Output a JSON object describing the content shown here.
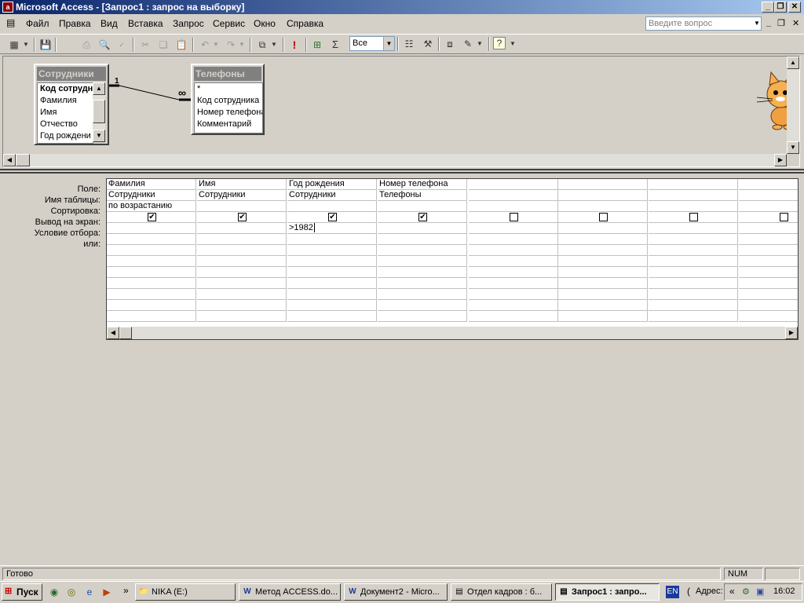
{
  "window": {
    "title": "Microsoft Access - [Запрос1 : запрос на выборку]",
    "app_icon": "access-icon"
  },
  "menubar": {
    "items": [
      "Файл",
      "Правка",
      "Вид",
      "Вставка",
      "Запрос",
      "Сервис",
      "Окно",
      "Справка"
    ],
    "ask_placeholder": "Введите вопрос"
  },
  "toolbar": {
    "top_values_combo": "Все",
    "icons": [
      "view-icon",
      "save-icon",
      "print-icon",
      "print-preview-icon",
      "spelling-icon",
      "cut-icon",
      "copy-icon",
      "paste-icon",
      "undo-icon",
      "redo-icon",
      "query-type-icon",
      "run-icon",
      "show-table-icon",
      "totals-icon",
      "properties-icon",
      "build-icon",
      "database-window-icon",
      "new-object-icon",
      "help-icon"
    ]
  },
  "tables": [
    {
      "title": "Сотрудники",
      "fields": [
        "Код сотрудн",
        "Фамилия",
        "Имя",
        "Отчество",
        "Год рождени"
      ]
    },
    {
      "title": "Телефоны",
      "fields": [
        "*",
        "Код сотрудника",
        "Номер телефона",
        "Комментарий"
      ]
    }
  ],
  "relationship": {
    "one_label": "1",
    "many_label": "∞"
  },
  "grid": {
    "row_labels": [
      "Поле:",
      "Имя таблицы:",
      "Сортировка:",
      "Вывод на экран:",
      "Условие отбора:",
      "или:"
    ],
    "columns": [
      {
        "field": "Фамилия",
        "table": "Сотрудники",
        "sort": "по возрастанию",
        "show": true,
        "criteria": "",
        "or": ""
      },
      {
        "field": "Имя",
        "table": "Сотрудники",
        "sort": "",
        "show": true,
        "criteria": "",
        "or": ""
      },
      {
        "field": "Год рождения",
        "table": "Сотрудники",
        "sort": "",
        "show": true,
        "criteria": ">1982",
        "or": ""
      },
      {
        "field": "Номер телефона",
        "table": "Телефоны",
        "sort": "",
        "show": true,
        "criteria": "",
        "or": ""
      },
      {
        "field": "",
        "table": "",
        "sort": "",
        "show": false,
        "criteria": "",
        "or": ""
      },
      {
        "field": "",
        "table": "",
        "sort": "",
        "show": false,
        "criteria": "",
        "or": ""
      },
      {
        "field": "",
        "table": "",
        "sort": "",
        "show": false,
        "criteria": "",
        "or": ""
      },
      {
        "field": "",
        "table": "",
        "sort": "",
        "show": false,
        "criteria": "",
        "or": ""
      }
    ]
  },
  "statusbar": {
    "text": "Готово",
    "num": "NUM"
  },
  "taskbar": {
    "start": "Пуск",
    "tasks": [
      {
        "label": "NIKA (E:)",
        "icon": "folder-icon",
        "active": false
      },
      {
        "label": "Метод ACCESS.do...",
        "icon": "word-icon",
        "active": false
      },
      {
        "label": "Документ2 - Micro...",
        "icon": "word-icon",
        "active": false
      },
      {
        "label": "Отдел кадров : б...",
        "icon": "access-icon",
        "active": false
      },
      {
        "label": "Запрос1 : запро...",
        "icon": "access-icon",
        "active": true
      }
    ],
    "lang": "EN",
    "address_label": "Адрес:",
    "clock": "16:02"
  }
}
